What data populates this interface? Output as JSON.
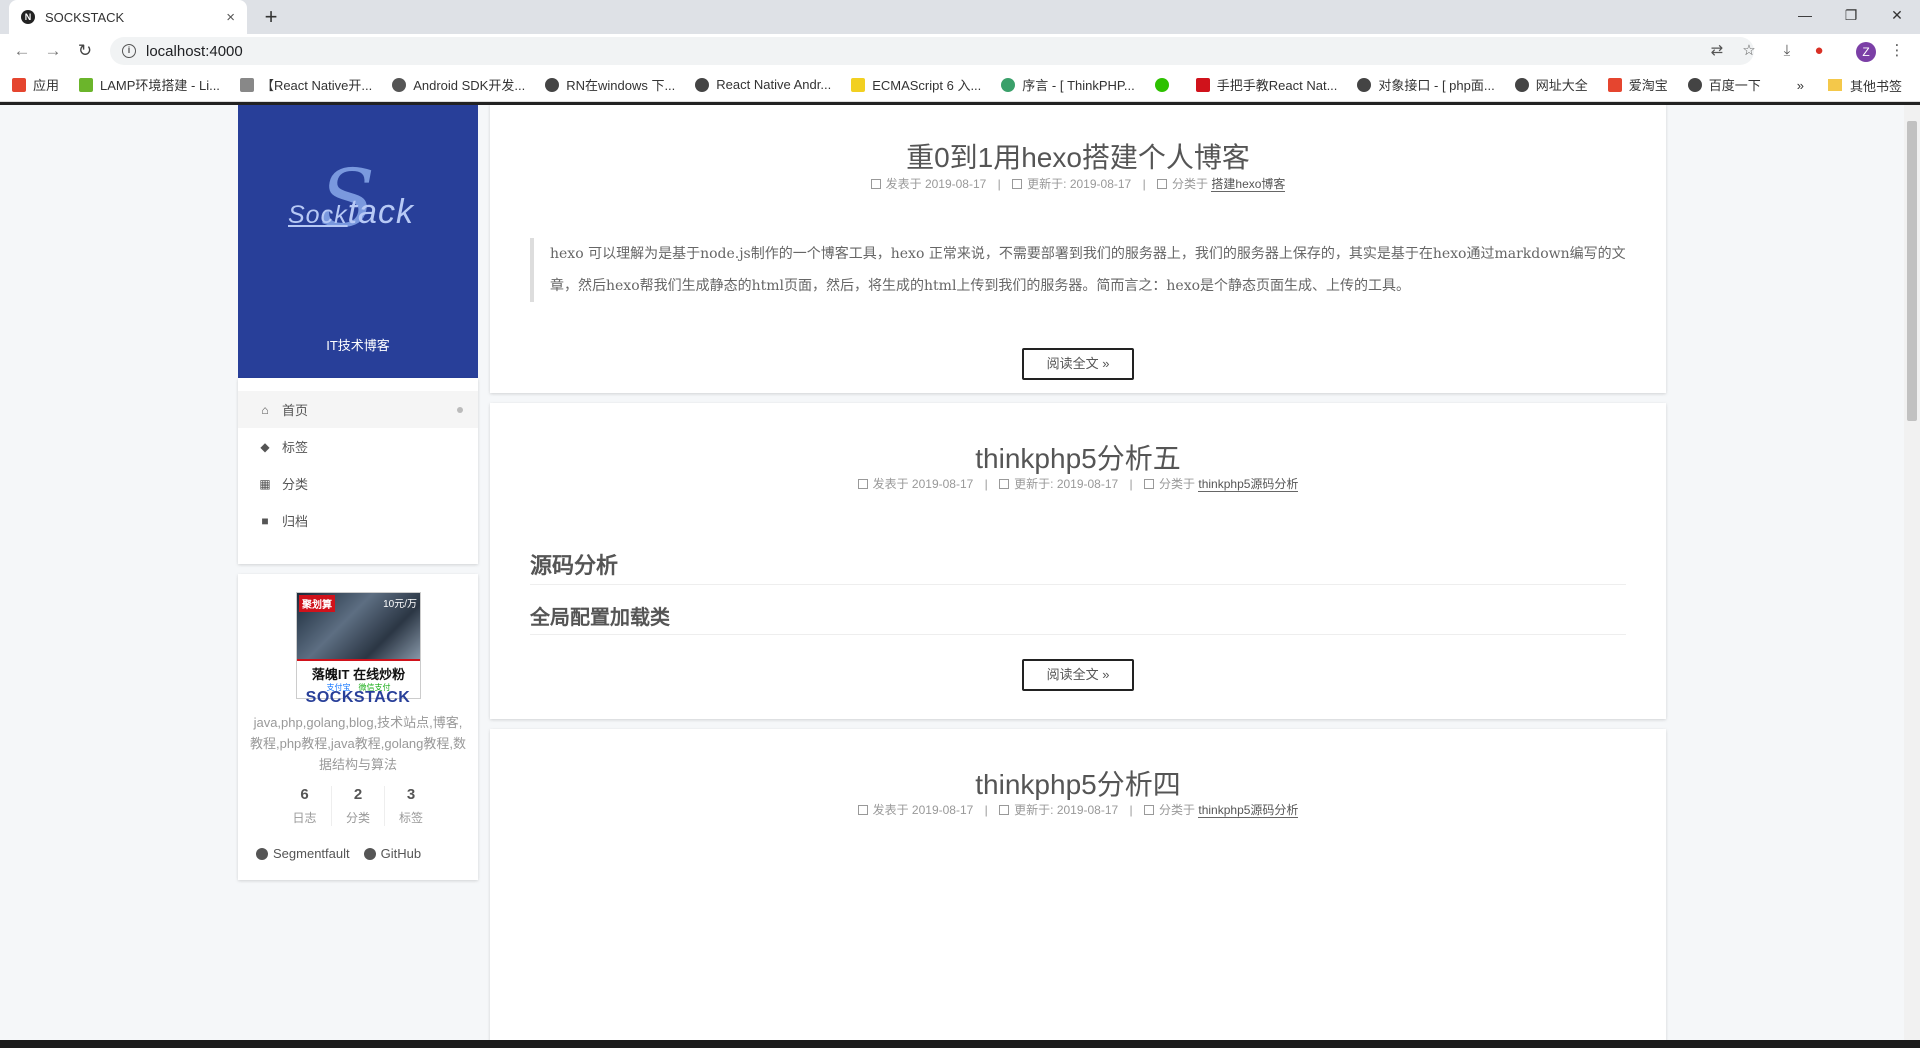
{
  "browser": {
    "tab_title": "SOCKSTACK",
    "favicon_letter": "N",
    "tab_close": "×",
    "new_tab": "+",
    "url": "localhost:4000",
    "avatar_letter": "Z",
    "bookmarks": [
      {
        "label": "应用",
        "color": "#e5452f"
      },
      {
        "label": "LAMP环境搭建 - Li...",
        "color": "#6bb52b"
      },
      {
        "label": "【React Native开...",
        "color": "#888888"
      },
      {
        "label": "Android SDK开发...",
        "color": "#555555"
      },
      {
        "label": "RN在windows 下...",
        "color": "#444444"
      },
      {
        "label": "React Native Andr...",
        "color": "#444444"
      },
      {
        "label": "ECMAScript 6 入...",
        "color": "#f2d021"
      },
      {
        "label": "序言 - [ ThinkPHP...",
        "color": "#3aa06a"
      },
      {
        "label": "",
        "color": "#2dc100"
      },
      {
        "label": "手把手教React Nat...",
        "color": "#d0121b"
      },
      {
        "label": "对象接口 - [ php面...",
        "color": "#444444"
      },
      {
        "label": "网址大全",
        "color": "#444444"
      },
      {
        "label": "爱淘宝",
        "color": "#e5452f"
      },
      {
        "label": "百度一下",
        "color": "#444444"
      }
    ],
    "bookmarks_more": "»",
    "other_bookmarks": "其他书签"
  },
  "site": {
    "logo_big": "S",
    "logo_small": "Sock",
    "logo_rest": "tack",
    "subtitle": "IT技术博客",
    "brand_color": "#283f99"
  },
  "menu": [
    {
      "label": "首页",
      "icon": "home-icon",
      "glyph": "⌂",
      "active": true
    },
    {
      "label": "标签",
      "icon": "tags-icon",
      "glyph": "◆",
      "active": false
    },
    {
      "label": "分类",
      "icon": "grid-icon",
      "glyph": "▦",
      "active": false
    },
    {
      "label": "归档",
      "icon": "archive-icon",
      "glyph": "■",
      "active": false
    }
  ],
  "profile": {
    "ad": {
      "tag": "聚划算",
      "price": "10元/万",
      "text": "落魄IT 在线炒粉",
      "pay1": "支付宝",
      "pay2": "微信支付"
    },
    "name": "SOCKSTACK",
    "description": "java,php,golang,blog,技术站点,博客,教程,php教程,java教程,golang教程,数据结构与算法",
    "stats": [
      {
        "num": "6",
        "label": "日志"
      },
      {
        "num": "2",
        "label": "分类"
      },
      {
        "num": "3",
        "label": "标签"
      }
    ],
    "links": [
      {
        "label": "Segmentfault"
      },
      {
        "label": "GitHub"
      }
    ]
  },
  "posts": [
    {
      "title": "重0到1用hexo搭建个人博客",
      "published_label": "发表于",
      "published": "2019-08-17",
      "updated_label": "更新于:",
      "updated": "2019-08-17",
      "category_label": "分类于",
      "category": "搭建hexo博客",
      "excerpt": "hexo 可以理解为是基于node.js制作的一个博客工具，hexo 正常来说，不需要部署到我们的服务器上，我们的服务器上保存的，其实是基于在hexo通过markdown编写的文章，然后hexo帮我们生成静态的html页面，然后，将生成的html上传到我们的服务器。简而言之：hexo是个静态页面生成、上传的工具。",
      "read_more": "阅读全文 »"
    },
    {
      "title": "thinkphp5分析五",
      "published_label": "发表于",
      "published": "2019-08-17",
      "updated_label": "更新于:",
      "updated": "2019-08-17",
      "category_label": "分类于",
      "category": "thinkphp5源码分析",
      "h2": "源码分析",
      "h3": "全局配置加载类",
      "read_more": "阅读全文 »"
    },
    {
      "title": "thinkphp5分析四",
      "published_label": "发表于",
      "published": "2019-08-17",
      "updated_label": "更新于:",
      "updated": "2019-08-17",
      "category_label": "分类于",
      "category": "thinkphp5源码分析"
    }
  ]
}
